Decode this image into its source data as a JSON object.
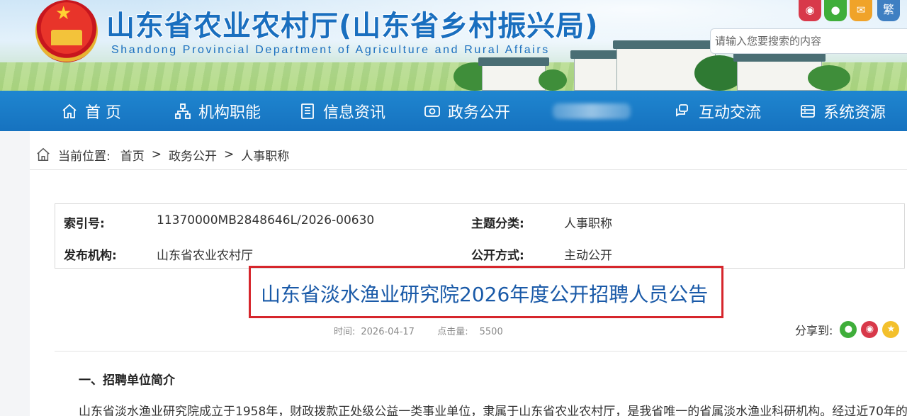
{
  "header": {
    "site_title": "山东省农业农村厅(山东省乡村振兴局)",
    "site_subtitle": "Shandong Provincial Department of Agriculture and Rural Affairs",
    "emblem_icon": "national-emblem-icon",
    "social": [
      {
        "name": "weibo",
        "icon": "weibo-icon"
      },
      {
        "name": "wechat",
        "icon": "wechat-icon"
      },
      {
        "name": "mail",
        "icon": "mail-icon"
      },
      {
        "name": "traditional",
        "label": "繁"
      }
    ],
    "search": {
      "placeholder": "请输入您要搜索的内容"
    }
  },
  "nav": {
    "items": [
      {
        "label": "首 页",
        "icon": "home-icon"
      },
      {
        "label": "机构职能",
        "icon": "org-chart-icon"
      },
      {
        "label": "信息资讯",
        "icon": "document-icon"
      },
      {
        "label": "政务公开",
        "icon": "eye-icon"
      },
      {
        "label": "互动交流",
        "icon": "chat-icon"
      },
      {
        "label": "系统资源",
        "icon": "database-icon"
      }
    ]
  },
  "breadcrumb": {
    "prefix": "当前位置:",
    "items": [
      "首页",
      "政务公开",
      "人事职称"
    ],
    "separator": ">"
  },
  "meta": {
    "index_label": "索引号:",
    "index_value": "11370000MB2848646L/2026-00630",
    "topic_label": "主题分类:",
    "topic_value": "人事职称",
    "publisher_label": "发布机构:",
    "publisher_value": "山东省农业农村厅",
    "disclosure_label": "公开方式:",
    "disclosure_value": "主动公开"
  },
  "article": {
    "title": "山东省淡水渔业研究院2026年度公开招聘人员公告",
    "time_label": "时间:",
    "time_value": "2026-04-17",
    "hits_label": "点击量:",
    "hits_value": "5500",
    "share_label": "分享到:",
    "section_heading": "一、招聘单位简介",
    "paragraph": "山东省淡水渔业研究院成立于1958年，财政拨款正处级公益一类事业单位，隶属于山东省农业农村厅，是我省唯一的省属淡水渔业科研机构。经过近70年的"
  },
  "colors": {
    "nav_bg": "#1672bf",
    "title_blue": "#1a5aa8",
    "highlight_red": "#d6262c"
  }
}
